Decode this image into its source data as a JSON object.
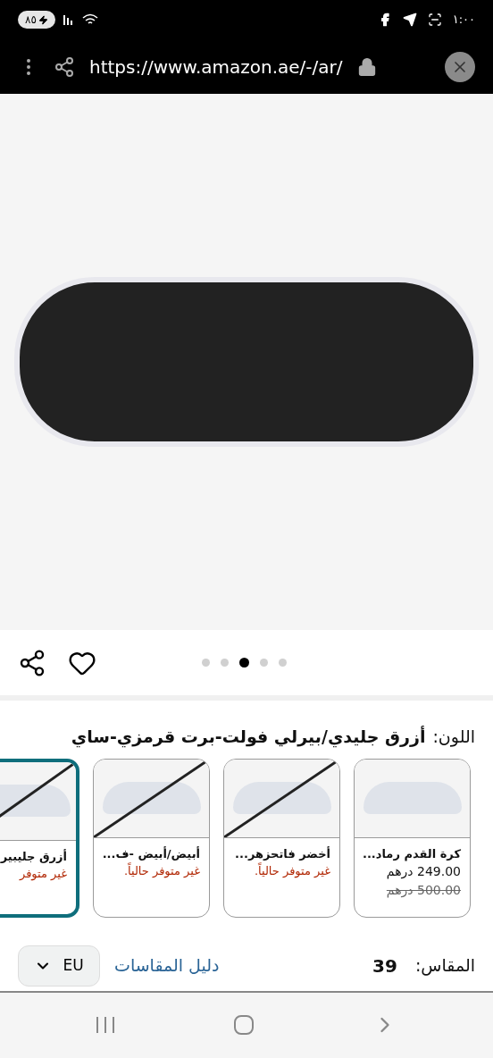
{
  "status_bar": {
    "battery": "٨٥",
    "time": "١:٠٠"
  },
  "browser": {
    "url": "https://www.amazon.ae/-/ar/"
  },
  "gallery": {
    "dots": [
      {
        "selected": false
      },
      {
        "selected": false
      },
      {
        "selected": true
      },
      {
        "selected": false
      },
      {
        "selected": false
      }
    ]
  },
  "color": {
    "label": "اللون:",
    "value": "أزرق جليدي/بيرلي فولت-برت قرمزي-ساي"
  },
  "swatches": [
    {
      "name": "كرة القدم رماد...",
      "available": true,
      "selected": false,
      "price": "249.00 درهم",
      "old_price": "500.00 درهم"
    },
    {
      "name": "أخضر فاتحزهر...",
      "available": false,
      "selected": false,
      "status": "غير متوفر حالياً."
    },
    {
      "name": "أبيض/أبيض -ف...",
      "available": false,
      "selected": false,
      "status": "غير متوفر حالياً."
    },
    {
      "name": "أزرق جليبير",
      "available": false,
      "selected": true,
      "status": "غير متوفر"
    }
  ],
  "size": {
    "label": "المقاس:",
    "value": "39",
    "guide_link": "دليل المقاسات",
    "system": "EU"
  }
}
